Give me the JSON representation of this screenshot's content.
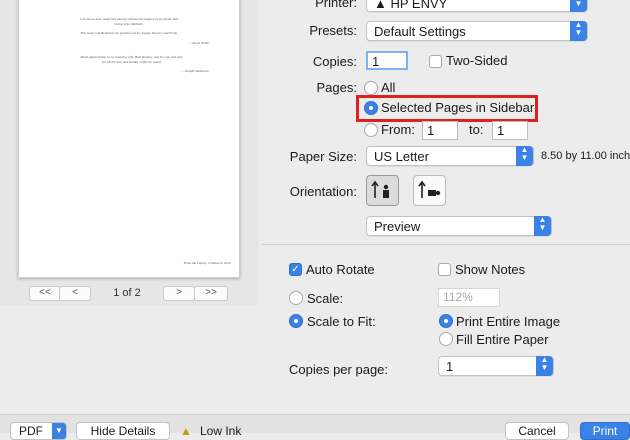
{
  "preview": {
    "page_lines": [
      "I could not have made this journey without the support of my family and",
      "loving wife, Michelle.",
      "This book is dedicated to my greatest works: Logan, Sawyer, and Emily.",
      "— Kevin White",
      "Much appreciation to my amazing wife, Beth Rooney, and her one and only",
      "for all the love and Sunday coffee he would",
      "— Jennifer Robinson"
    ],
    "footer_text": "From the Library of Rebecca Wool",
    "pager": {
      "first": "<<",
      "prev": "<",
      "label": "1 of 2",
      "next": ">",
      "last": ">>"
    }
  },
  "printer": {
    "label": "Printer:",
    "value": "HP ENVY"
  },
  "presets": {
    "label": "Presets:",
    "value": "Default Settings"
  },
  "copies": {
    "label": "Copies:",
    "value": "1",
    "two_sided_label": "Two-Sided"
  },
  "pages": {
    "label": "Pages:",
    "all_label": "All",
    "selected_label": "Selected Pages in Sidebar",
    "from_label": "From:",
    "from_value": "1",
    "to_label": "to:",
    "to_value": "1"
  },
  "paper_size": {
    "label": "Paper Size:",
    "value": "US Letter",
    "dimensions": "8.50 by 11.00 inch"
  },
  "orientation": {
    "label": "Orientation:"
  },
  "section_popup": {
    "value": "Preview"
  },
  "options": {
    "auto_rotate": "Auto Rotate",
    "show_notes": "Show Notes",
    "scale_label": "Scale:",
    "scale_value": "112%",
    "scale_to_fit": "Scale to Fit:",
    "print_entire_image": "Print Entire Image",
    "fill_entire_paper": "Fill Entire Paper",
    "copies_per_page_label": "Copies per page:",
    "copies_per_page_value": "1"
  },
  "bottom": {
    "pdf": "PDF",
    "hide_details": "Hide Details",
    "low_ink": "Low Ink",
    "cancel": "Cancel",
    "print": "Print"
  },
  "colors": {
    "accent": "#3b82e6",
    "highlight": "#e0201f"
  }
}
